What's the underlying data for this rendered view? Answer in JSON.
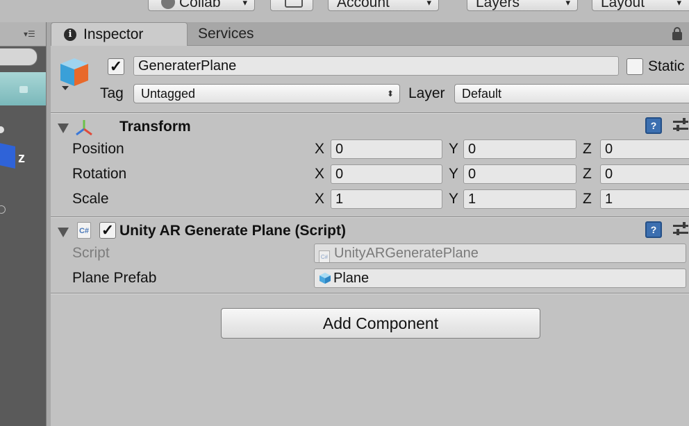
{
  "toolbar": {
    "collab_label": "Collab",
    "account_label": "Account",
    "layers_label": "Layers",
    "layout_label": "Layout"
  },
  "scene": {
    "axis_label": "z"
  },
  "tabs": {
    "inspector_label": "Inspector",
    "services_label": "Services"
  },
  "gameobject": {
    "name": "GeneraterPlane",
    "active": true,
    "static_label": "Static",
    "tag_label": "Tag",
    "tag_value": "Untagged",
    "layer_label": "Layer",
    "layer_value": "Default"
  },
  "transform": {
    "title": "Transform",
    "position_label": "Position",
    "rotation_label": "Rotation",
    "scale_label": "Scale",
    "axis_x": "X",
    "axis_y": "Y",
    "axis_z": "Z",
    "position": {
      "x": "0",
      "y": "0",
      "z": "0"
    },
    "rotation": {
      "x": "0",
      "y": "0",
      "z": "0"
    },
    "scale": {
      "x": "1",
      "y": "1",
      "z": "1"
    }
  },
  "script_component": {
    "title": "Unity AR Generate Plane (Script)",
    "enabled": true,
    "cs_badge": "C#",
    "script_label": "Script",
    "script_value": "UnityARGeneratePlane",
    "prefab_label": "Plane Prefab",
    "prefab_value": "Plane"
  },
  "add_component_label": "Add Component",
  "colors": {
    "panel_bg": "#c2c2c2",
    "tab_bar_bg": "#a7a7a7",
    "scene_bg": "#5a5a5a",
    "help_icon_blue": "#3c6fb0"
  }
}
